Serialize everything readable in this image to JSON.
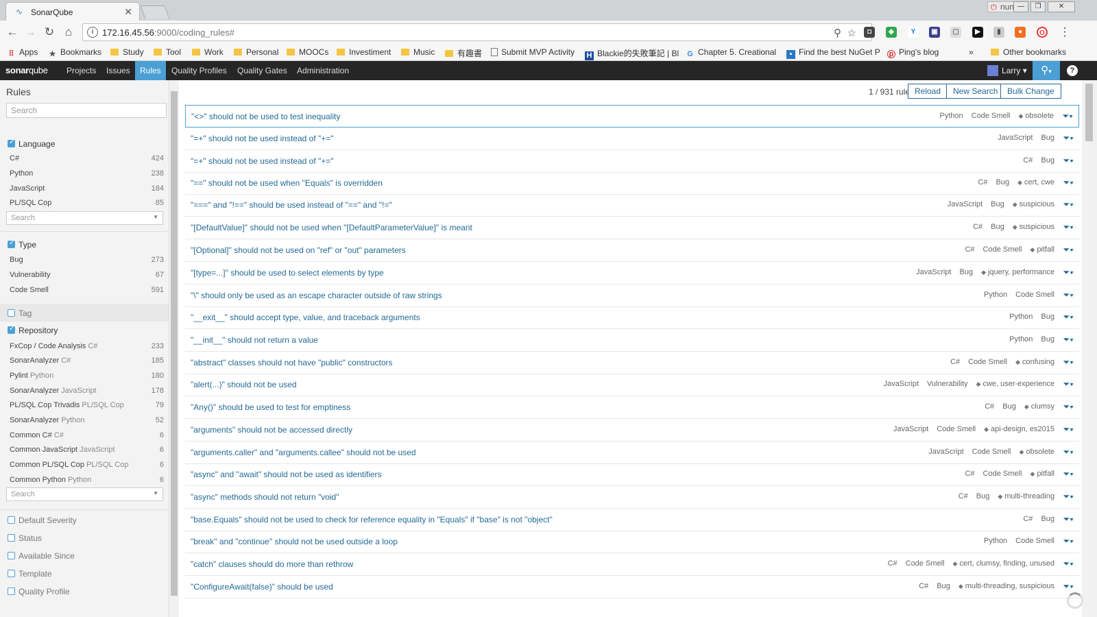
{
  "browser": {
    "tab_title": "SonarQube",
    "profile_name": "nung",
    "url_host": "172.16.45.56",
    "url_path": ":9000/coding_rules#",
    "bookmarks": [
      "Apps",
      "Bookmarks",
      "Study",
      "Tool",
      "Work",
      "Personal",
      "MOOCs",
      "Investiment",
      "Music",
      "有趣書",
      "Submit MVP Activity",
      "Blackie的失敗筆記 | Bl",
      "Chapter 5. Creational",
      "Find the best NuGet P",
      "Ping's blog",
      "»",
      "Other bookmarks"
    ]
  },
  "nav": {
    "logo_sonar": "sonar",
    "logo_qube": "qube",
    "links": [
      "Projects",
      "Issues",
      "Rules",
      "Quality Profiles",
      "Quality Gates",
      "Administration"
    ],
    "user": "Larry"
  },
  "sidebar": {
    "title": "Rules",
    "search_placeholder": "Search",
    "facet_search_placeholder": "Search",
    "language": {
      "label": "Language",
      "items": [
        {
          "name": "C#",
          "count": "424"
        },
        {
          "name": "Python",
          "count": "238"
        },
        {
          "name": "JavaScript",
          "count": "184"
        },
        {
          "name": "PL/SQL Cop",
          "count": "85"
        }
      ]
    },
    "type": {
      "label": "Type",
      "items": [
        {
          "name": "Bug",
          "count": "273"
        },
        {
          "name": "Vulnerability",
          "count": "67"
        },
        {
          "name": "Code Smell",
          "count": "591"
        }
      ]
    },
    "tag_label": "Tag",
    "repository": {
      "label": "Repository",
      "items": [
        {
          "name": "FxCop / Code Analysis",
          "sub": "C#",
          "count": "233"
        },
        {
          "name": "SonarAnalyzer",
          "sub": "C#",
          "count": "185"
        },
        {
          "name": "Pylint",
          "sub": "Python",
          "count": "180"
        },
        {
          "name": "SonarAnalyzer",
          "sub": "JavaScript",
          "count": "178"
        },
        {
          "name": "PL/SQL Cop Trivadis",
          "sub": "PL/SQL Cop",
          "count": "79"
        },
        {
          "name": "SonarAnalyzer",
          "sub": "Python",
          "count": "52"
        },
        {
          "name": "Common C#",
          "sub": "C#",
          "count": "6"
        },
        {
          "name": "Common JavaScript",
          "sub": "JavaScript",
          "count": "6"
        },
        {
          "name": "Common PL/SQL Cop",
          "sub": "PL/SQL Cop",
          "count": "6"
        },
        {
          "name": "Common Python",
          "sub": "Python",
          "count": "6"
        }
      ]
    },
    "other_facets": [
      "Default Severity",
      "Status",
      "Available Since",
      "Template",
      "Quality Profile"
    ]
  },
  "main": {
    "counter": "1 / 931 rules",
    "buttons": {
      "reload": "Reload",
      "new_search": "New Search",
      "bulk_change": "Bulk Change"
    },
    "rules": [
      {
        "name": "\"<>\" should not be used to test inequality",
        "lang": "Python",
        "type": "Code Smell",
        "tags": "obsolete"
      },
      {
        "name": "\"=+\" should not be used instead of \"+=\"",
        "lang": "JavaScript",
        "type": "Bug",
        "tags": ""
      },
      {
        "name": "\"=+\" should not be used instead of \"+=\"",
        "lang": "C#",
        "type": "Bug",
        "tags": ""
      },
      {
        "name": "\"==\" should not be used when \"Equals\" is overridden",
        "lang": "C#",
        "type": "Bug",
        "tags": "cert, cwe"
      },
      {
        "name": "\"===\" and \"!==\" should be used instead of \"==\" and \"!=\"",
        "lang": "JavaScript",
        "type": "Bug",
        "tags": "suspicious"
      },
      {
        "name": "\"[DefaultValue]\" should not be used when \"[DefaultParameterValue]\" is meant",
        "lang": "C#",
        "type": "Bug",
        "tags": "suspicious"
      },
      {
        "name": "\"[Optional]\" should not be used on \"ref\" or \"out\" parameters",
        "lang": "C#",
        "type": "Code Smell",
        "tags": "pitfall"
      },
      {
        "name": "\"[type=...]\" should be used to select elements by type",
        "lang": "JavaScript",
        "type": "Bug",
        "tags": "jquery, performance"
      },
      {
        "name": "\"\\\" should only be used as an escape character outside of raw strings",
        "lang": "Python",
        "type": "Code Smell",
        "tags": ""
      },
      {
        "name": "\"__exit__\" should accept type, value, and traceback arguments",
        "lang": "Python",
        "type": "Bug",
        "tags": ""
      },
      {
        "name": "\"__init__\" should not return a value",
        "lang": "Python",
        "type": "Bug",
        "tags": ""
      },
      {
        "name": "\"abstract\" classes should not have \"public\" constructors",
        "lang": "C#",
        "type": "Code Smell",
        "tags": "confusing"
      },
      {
        "name": "\"alert(...)\" should not be used",
        "lang": "JavaScript",
        "type": "Vulnerability",
        "tags": "cwe, user-experience"
      },
      {
        "name": "\"Any()\" should be used to test for emptiness",
        "lang": "C#",
        "type": "Bug",
        "tags": "clumsy"
      },
      {
        "name": "\"arguments\" should not be accessed directly",
        "lang": "JavaScript",
        "type": "Code Smell",
        "tags": "api-design, es2015"
      },
      {
        "name": "\"arguments.caller\" and \"arguments.callee\" should not be used",
        "lang": "JavaScript",
        "type": "Code Smell",
        "tags": "obsolete"
      },
      {
        "name": "\"async\" and \"await\" should not be used as identifiers",
        "lang": "C#",
        "type": "Code Smell",
        "tags": "pitfall"
      },
      {
        "name": "\"async\" methods should not return \"void\"",
        "lang": "C#",
        "type": "Bug",
        "tags": "multi-threading"
      },
      {
        "name": "\"base.Equals\" should not be used to check for reference equality in \"Equals\" if \"base\" is not \"object\"",
        "lang": "C#",
        "type": "Bug",
        "tags": ""
      },
      {
        "name": "\"break\" and \"continue\" should not be used outside a loop",
        "lang": "Python",
        "type": "Code Smell",
        "tags": ""
      },
      {
        "name": "\"catch\" clauses should do more than rethrow",
        "lang": "C#",
        "type": "Code Smell",
        "tags": "cert, clumsy, finding, unused"
      },
      {
        "name": "\"ConfigureAwait(false)\" should be used",
        "lang": "C#",
        "type": "Bug",
        "tags": "multi-threading, suspicious"
      }
    ]
  }
}
